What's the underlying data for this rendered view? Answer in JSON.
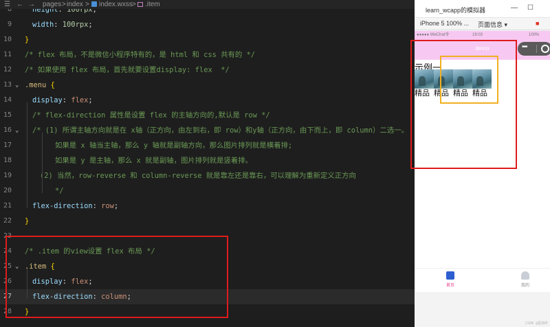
{
  "breadcrumb": {
    "pages": "pages",
    "sep": ">",
    "index": "index",
    "file": "index.wxss",
    "item": ".item"
  },
  "editor": {
    "lines": [
      {
        "num": "8",
        "parts": [
          [
            "prop",
            "height"
          ],
          [
            "punc",
            ": "
          ],
          [
            "num",
            "100rpx"
          ],
          [
            "punc",
            ";"
          ]
        ]
      },
      {
        "num": "9",
        "parts": [
          [
            "prop",
            "width"
          ],
          [
            "punc",
            ": "
          ],
          [
            "num",
            "100rpx"
          ],
          [
            "punc",
            ";"
          ]
        ]
      },
      {
        "num": "10",
        "parts": [
          [
            "brace",
            "}"
          ]
        ]
      },
      {
        "num": "11",
        "parts": [
          [
            "cm",
            "/* flex 布局，不是微信小程序特有的，是 html 和 css 共有的 */"
          ]
        ]
      },
      {
        "num": "12",
        "parts": [
          [
            "cm",
            "/* 如果使用 flex 布局，首先就要设置display: flex  */"
          ]
        ]
      },
      {
        "num": "13",
        "parts": [
          [
            "sel",
            ".menu"
          ],
          [
            "punc",
            " "
          ],
          [
            "brace",
            "{"
          ]
        ]
      },
      {
        "num": "14",
        "parts": [
          [
            "prop",
            "display"
          ],
          [
            "punc",
            ": "
          ],
          [
            "val",
            "flex"
          ],
          [
            "punc",
            ";"
          ]
        ]
      },
      {
        "num": "15",
        "parts": [
          [
            "cm",
            "/* flex-direction 属性是设置 flex 的主轴方向的,默认是 row */"
          ]
        ]
      },
      {
        "num": "16",
        "parts": [
          [
            "cm",
            "/* (1) 所谓主轴方向就是在 x轴（正方向，由左到右，即 row）和y轴（正方向，由下而上，即 column）二选一。"
          ]
        ]
      },
      {
        "num": "17",
        "parts": [
          [
            "cm",
            "如果是 x 轴当主轴，那么 y 轴就是副轴方向，那么图片排列就是横着排;"
          ]
        ]
      },
      {
        "num": "18",
        "parts": [
          [
            "cm",
            "如果是 y 是主轴，那么 x 就是副轴，图片排列就是竖着排。"
          ]
        ]
      },
      {
        "num": "19",
        "parts": [
          [
            "cm",
            "(2) 当然，row-reverse 和 column-reverse 就是靠左还是靠右，可以理解为重新定义正方向"
          ]
        ]
      },
      {
        "num": "20",
        "parts": [
          [
            "cm",
            "*/"
          ]
        ]
      },
      {
        "num": "21",
        "parts": [
          [
            "prop",
            "flex-direction"
          ],
          [
            "punc",
            ": "
          ],
          [
            "val",
            "row"
          ],
          [
            "punc",
            ";"
          ]
        ]
      },
      {
        "num": "22",
        "parts": [
          [
            "brace",
            "}"
          ]
        ]
      },
      {
        "num": "23",
        "parts": []
      },
      {
        "num": "24",
        "parts": [
          [
            "cm",
            "/* .item 的view设置 flex 布局 */"
          ]
        ]
      },
      {
        "num": "25",
        "parts": [
          [
            "sel",
            ".item"
          ],
          [
            "punc",
            " "
          ],
          [
            "brace",
            "{"
          ]
        ]
      },
      {
        "num": "26",
        "parts": [
          [
            "prop",
            "display"
          ],
          [
            "punc",
            ": "
          ],
          [
            "val",
            "flex"
          ],
          [
            "punc",
            ";"
          ]
        ]
      },
      {
        "num": "27",
        "parts": [
          [
            "prop",
            "flex-direction"
          ],
          [
            "punc",
            ": "
          ],
          [
            "val",
            "column"
          ],
          [
            "punc",
            ";"
          ]
        ]
      },
      {
        "num": "28",
        "parts": [
          [
            "brace",
            "}"
          ]
        ]
      }
    ]
  },
  "simulator": {
    "window_title": "learn_wcapp的模拟器",
    "device": "iPhone 5 100% ...",
    "page_info": "页面信息 ▾",
    "status_left": "●●●●● WeChat令",
    "status_time": "19:03",
    "status_right": "100%",
    "nav_title": "demo",
    "example_title": "示例一",
    "item_label": "精品",
    "item_count": 4,
    "tabs": [
      {
        "label": "首页",
        "color": "#e83e8c"
      },
      {
        "label": "我的",
        "color": "#888888"
      }
    ]
  },
  "watermark": "CSDN @墨渐终",
  "colors": {
    "highlight_box": "#e01b1b",
    "item_box": "#f0b020",
    "navbar": "#f7c8f2"
  }
}
